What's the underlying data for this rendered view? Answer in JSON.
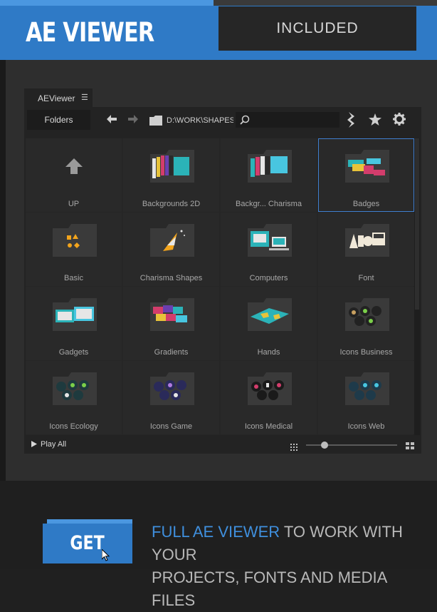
{
  "header": {
    "title": "AE VIEWER",
    "badge": "INCLUDED"
  },
  "panel": {
    "tab_label": "AEViewer",
    "folders_label": "Folders",
    "path": "D:\\WORK\\SHAPES\\",
    "search_placeholder": "",
    "play_all": "Play All",
    "zoom_level": 0.2
  },
  "grid": {
    "items": [
      {
        "label": "UP",
        "icon": "up-arrow-icon"
      },
      {
        "label": "Backgrounds 2D",
        "icon": "folder-icon"
      },
      {
        "label": "Backgr... Charisma",
        "icon": "folder-icon"
      },
      {
        "label": "Badges",
        "icon": "folder-icon",
        "selected": true
      },
      {
        "label": "Basic",
        "icon": "folder-icon"
      },
      {
        "label": "Charisma Shapes",
        "icon": "folder-icon"
      },
      {
        "label": "Computers",
        "icon": "folder-icon"
      },
      {
        "label": "Font",
        "icon": "folder-icon"
      },
      {
        "label": "Gadgets",
        "icon": "folder-icon"
      },
      {
        "label": "Gradients",
        "icon": "folder-icon"
      },
      {
        "label": "Hands",
        "icon": "folder-icon"
      },
      {
        "label": "Icons Business",
        "icon": "folder-icon"
      },
      {
        "label": "Icons Ecology",
        "icon": "folder-icon"
      },
      {
        "label": "Icons Game",
        "icon": "folder-icon"
      },
      {
        "label": "Icons Medical",
        "icon": "folder-icon"
      },
      {
        "label": "Icons Web",
        "icon": "folder-icon"
      }
    ]
  },
  "promo": {
    "get_label": "GET",
    "highlight": "FULL AE VIEWER",
    "rest_line1": " TO WORK WITH YOUR",
    "line2": "PROJECTS, FONTS AND MEDIA FILES"
  },
  "colors": {
    "accent": "#2f7ac6",
    "highlight_text": "#3f8fdd",
    "selection": "#3f7fd0"
  }
}
